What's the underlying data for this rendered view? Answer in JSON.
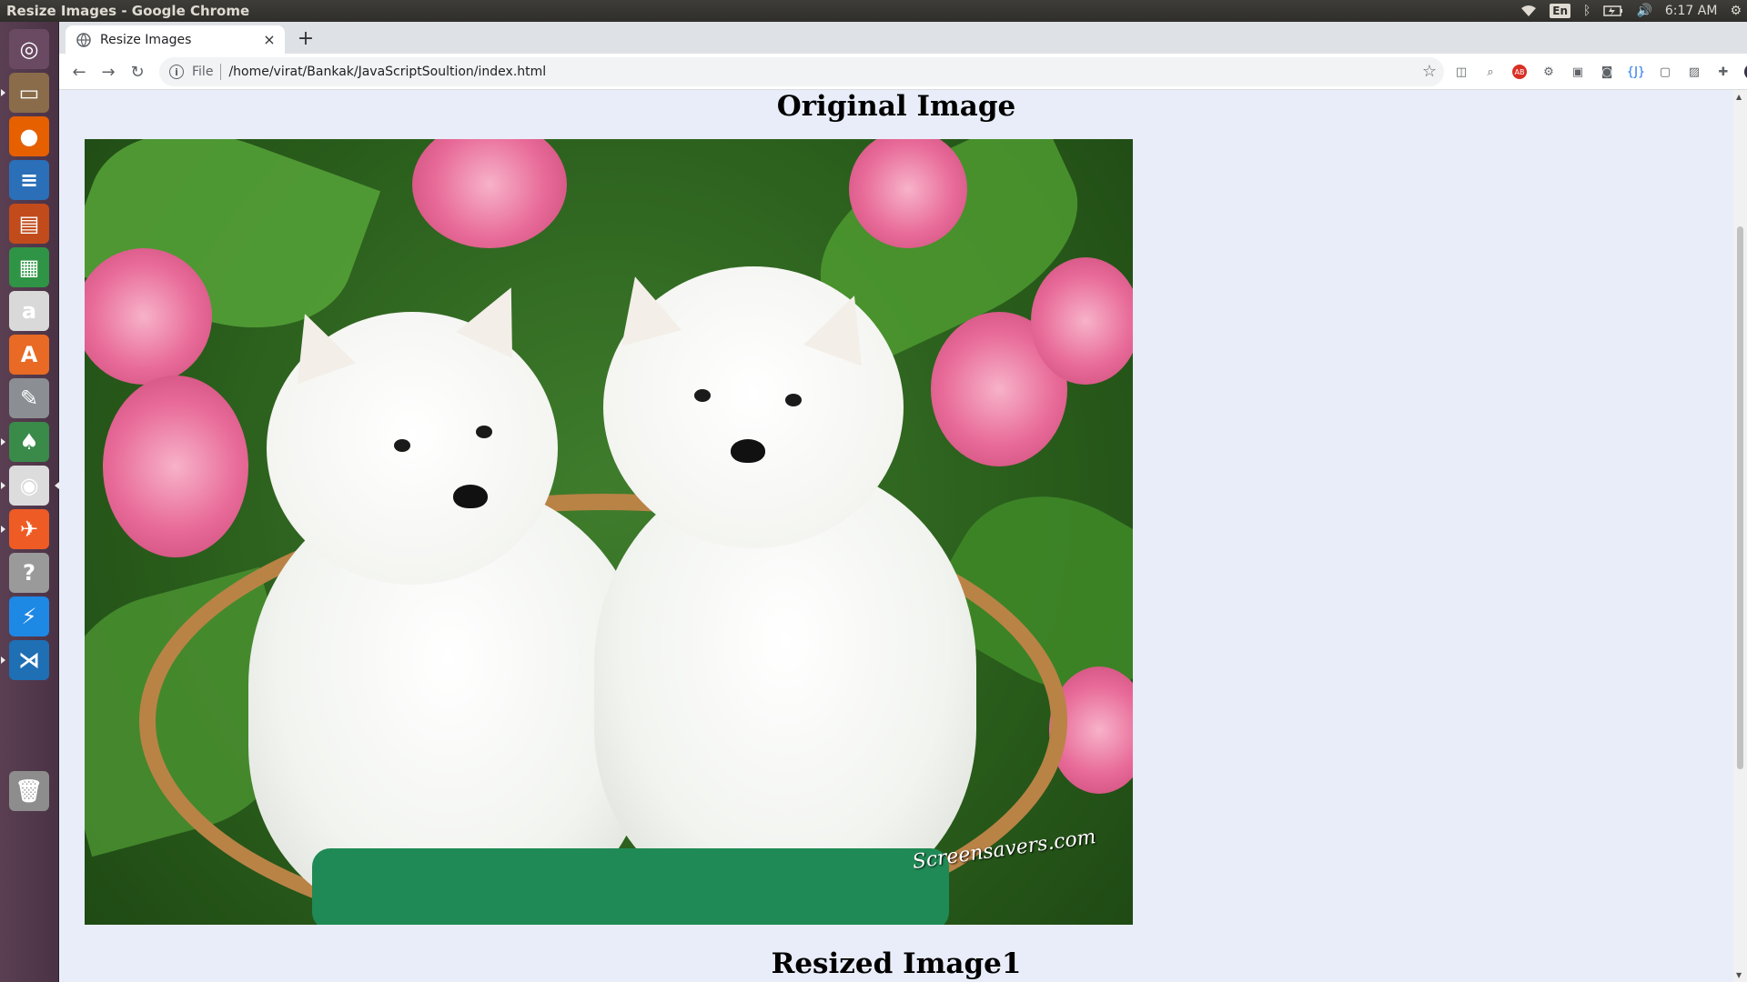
{
  "window": {
    "title": "Resize Images - Google Chrome"
  },
  "system_tray": {
    "language": "En",
    "time": "6:17 AM"
  },
  "launcher": {
    "items": [
      {
        "name": "ubuntu-dash-icon",
        "glyph": "◎",
        "color": "#6a4a62"
      },
      {
        "name": "files-icon",
        "glyph": "▭",
        "color": "#8a6c4a"
      },
      {
        "name": "firefox-icon",
        "glyph": "●",
        "color": "#e66000"
      },
      {
        "name": "libreoffice-writer-icon",
        "glyph": "≡",
        "color": "#2a6fb8"
      },
      {
        "name": "libreoffice-impress-icon",
        "glyph": "▤",
        "color": "#c24b1b"
      },
      {
        "name": "libreoffice-calc-icon",
        "glyph": "▦",
        "color": "#2f9446"
      },
      {
        "name": "amazon-icon",
        "glyph": "a",
        "color": "#d9d9d9"
      },
      {
        "name": "software-center-icon",
        "glyph": "A",
        "color": "#e86a24"
      },
      {
        "name": "system-settings-icon",
        "glyph": "✎",
        "color": "#8b8f93"
      },
      {
        "name": "gitkraken-icon",
        "glyph": "♠",
        "color": "#3a8a4a"
      },
      {
        "name": "chrome-icon",
        "glyph": "◉",
        "color": "#dcdcdc"
      },
      {
        "name": "postman-icon",
        "glyph": "✈",
        "color": "#ef5b25"
      },
      {
        "name": "help-icon",
        "glyph": "?",
        "color": "#9a9a9a"
      },
      {
        "name": "messenger-icon",
        "glyph": "⚡",
        "color": "#1e88e5"
      },
      {
        "name": "vscode-icon",
        "glyph": "⋊",
        "color": "#1f6fb5"
      },
      {
        "name": "trash-icon",
        "glyph": "🗑",
        "color": "#8d8d8d"
      }
    ]
  },
  "browser": {
    "tab_title": "Resize Images",
    "tab_close": "×",
    "new_tab": "+",
    "omnibox": {
      "scheme_label": "File",
      "url": "/home/virat/Bankak/JavaScriptSoultion/index.html"
    }
  },
  "page": {
    "heading_original": "Original Image",
    "heading_resized": "Resized Image1",
    "watermark": "Screensavers.com"
  }
}
